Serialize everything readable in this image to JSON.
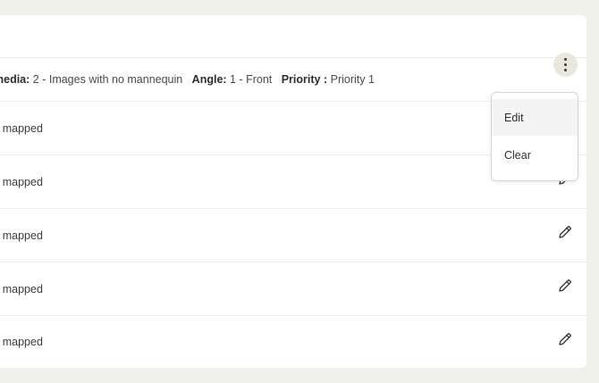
{
  "row_header": {
    "media_label": "media:",
    "media_value": "2 - Images with no mannequin",
    "angle_label": "Angle:",
    "angle_value": "1 - Front",
    "priority_label": "Priority :",
    "priority_value": "Priority 1"
  },
  "rows": [
    {
      "text": "x mapped"
    },
    {
      "text": "x mapped"
    },
    {
      "text": "x mapped"
    },
    {
      "text": "x mapped"
    },
    {
      "text": "x mapped"
    }
  ],
  "menu": {
    "edit_label": "Edit",
    "clear_label": "Clear"
  },
  "icons": {
    "kebab": "more-vertical-icon",
    "edit": "pencil-icon"
  }
}
